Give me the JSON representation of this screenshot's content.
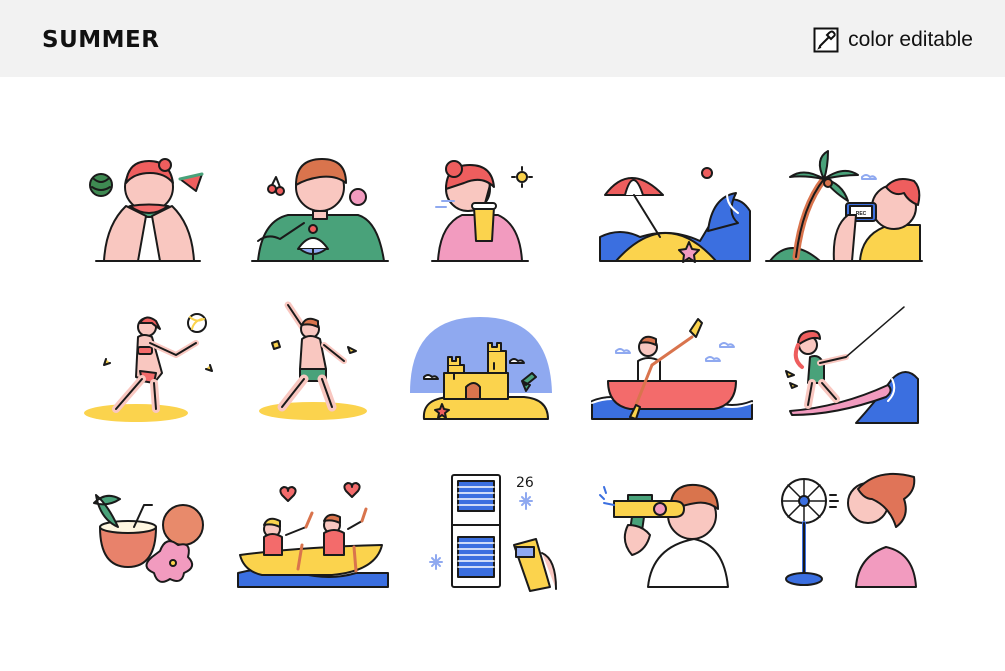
{
  "header": {
    "title": "SUMMER",
    "editable_label": "color editable",
    "editable_icon": "eyedropper-icon"
  },
  "palette": {
    "outline": "#1a1a1a",
    "skin": "#f9c7c0",
    "hair_red": "#ee5e5e",
    "hair_brown": "#d9744d",
    "green": "#49a27a",
    "yellow": "#fbd34d",
    "blue": "#3b6fe0",
    "light_blue": "#8fa9f0",
    "pink": "#f29bbf",
    "coral": "#f36b6b"
  },
  "illustrations": [
    {
      "name": "watermelon-girl-icon"
    },
    {
      "name": "shaved-ice-boy-icon"
    },
    {
      "name": "iced-drink-girl-icon"
    },
    {
      "name": "beach-umbrella-island-icon"
    },
    {
      "name": "palm-tree-photo-icon"
    },
    {
      "name": "beach-volleyball-girl-icon"
    },
    {
      "name": "swimming-boy-icon"
    },
    {
      "name": "sandcastle-icon"
    },
    {
      "name": "canoe-paddler-icon"
    },
    {
      "name": "wakeboard-girl-icon"
    },
    {
      "name": "coconut-drink-icon"
    },
    {
      "name": "banana-boat-icon"
    },
    {
      "name": "air-conditioner-icon"
    },
    {
      "name": "water-gun-boy-icon"
    },
    {
      "name": "electric-fan-girl-icon"
    }
  ],
  "captions": {
    "temperature": "26",
    "camera_rec": "REC"
  }
}
